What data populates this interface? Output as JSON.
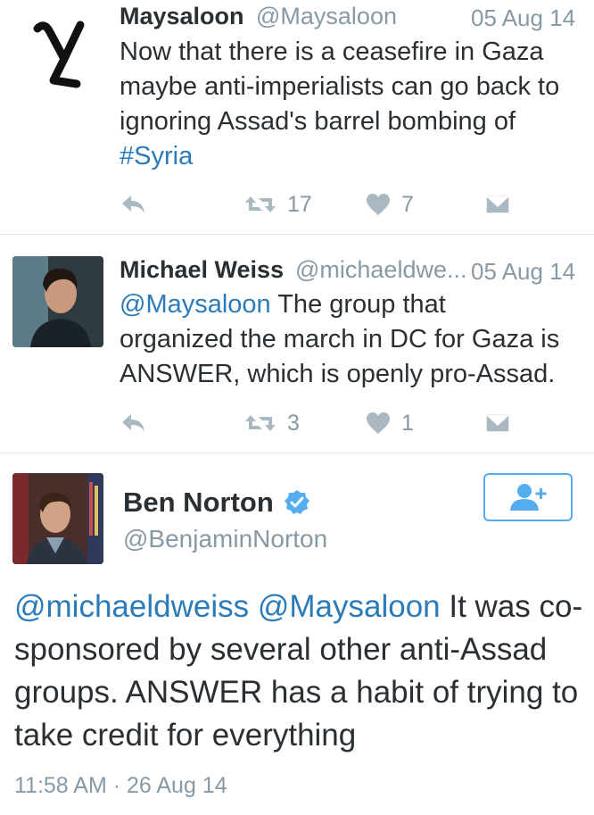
{
  "tweets": [
    {
      "name": "Maysaloon",
      "handle": "@Maysaloon",
      "date": "05 Aug 14",
      "text": "Now that there is a ceasefire in Gaza maybe anti-imperialists can go back to ignoring Assad's barrel bombing of ",
      "hashtag": "#Syria",
      "retweets": "17",
      "likes": "7"
    },
    {
      "name": "Michael Weiss",
      "handle": "@michaeldwe...",
      "date": "05 Aug 14",
      "mention": "@Maysaloon",
      "text": " The group that organized the march in DC for Gaza is ANSWER, which is openly pro-Assad.",
      "retweets": "3",
      "likes": "1"
    }
  ],
  "main_tweet": {
    "name": "Ben Norton",
    "handle": "@BenjaminNorton",
    "mention1": "@michaeldweiss",
    "mention2": "@Maysaloon",
    "text": " It was co-sponsored by several other anti-Assad groups. ANSWER has a habit of trying to take credit for everything",
    "timestamp": "11:58 AM · 26 Aug 14"
  },
  "icons": {
    "reply": "reply-icon",
    "retweet": "retweet-icon",
    "like": "heart-icon",
    "dm": "envelope-icon",
    "verified": "verified-badge-icon",
    "follow": "follow-user-icon"
  },
  "colors": {
    "link": "#2b7bb9",
    "muted": "#8899a6",
    "icon": "#aab8c2",
    "accent": "#55acee"
  }
}
